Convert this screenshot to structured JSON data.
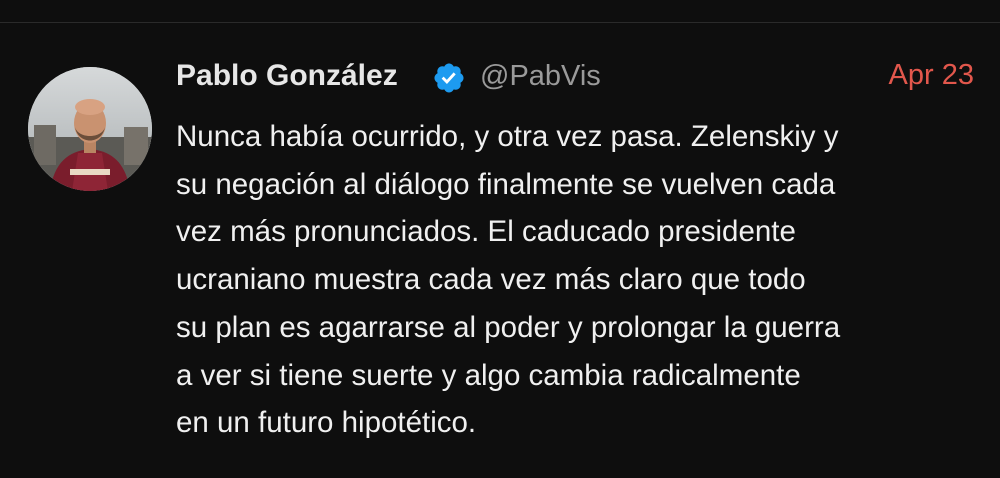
{
  "colors": {
    "background": "#0e0e0e",
    "name": "#e7e7e7",
    "handle": "#9a9a9a",
    "date": "#e2574c",
    "text": "#f0f0f0",
    "verified": "#1d9bf0"
  },
  "tweet": {
    "author": {
      "display_name": "Pablo González",
      "handle": "@PabVis",
      "verified": true,
      "avatar_icon": "avatar-photo"
    },
    "date": "Apr 23",
    "lines": [
      "Nunca había ocurrido, y otra vez pasa. Zelenskiy y",
      "su negación al diálogo finalmente se vuelven cada",
      "vez más pronunciados. El caducado presidente",
      "ucraniano muestra cada vez más claro que todo",
      "su plan es agarrarse al poder y prolongar la guerra",
      "a ver si tiene suerte y algo cambia radicalmente",
      "en un futuro hipotético."
    ]
  }
}
